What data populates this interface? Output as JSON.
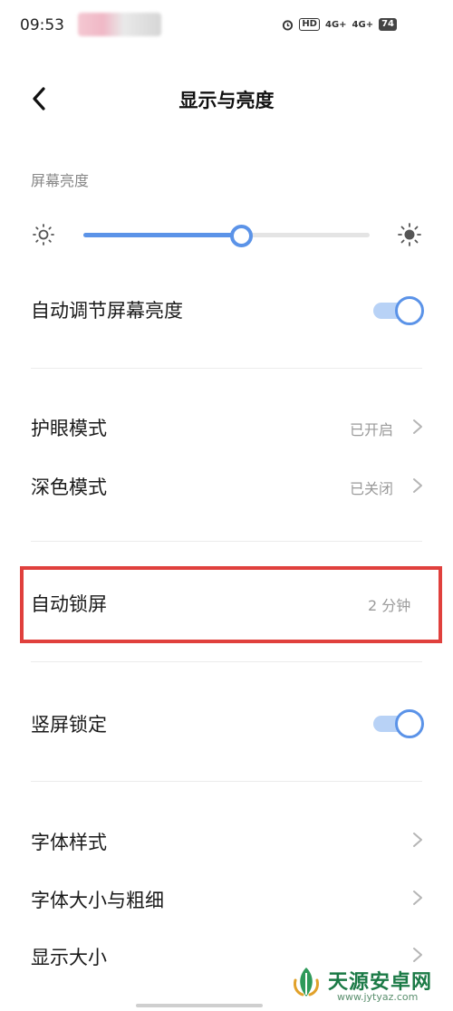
{
  "status_bar": {
    "time": "09:53",
    "battery": "74",
    "network1": "4G+",
    "network2": "4G+",
    "hd_badge": "HD"
  },
  "header": {
    "title": "显示与亮度"
  },
  "brightness": {
    "section_label": "屏幕亮度",
    "level": 0.55
  },
  "rows": {
    "auto_brightness": {
      "label": "自动调节屏幕亮度",
      "on": true
    },
    "eye_care": {
      "label": "护眼模式",
      "value": "已开启"
    },
    "dark_mode": {
      "label": "深色模式",
      "value": "已关闭"
    },
    "auto_lock": {
      "label": "自动锁屏",
      "value": "2 分钟"
    },
    "portrait_lock": {
      "label": "竖屏锁定",
      "on": true
    },
    "font_style": {
      "label": "字体样式"
    },
    "font_size_weight": {
      "label": "字体大小与粗细"
    },
    "display_size": {
      "label": "显示大小"
    }
  },
  "watermark": {
    "name": "天源安卓网",
    "url": "www.jytyaz.com"
  },
  "colors": {
    "accent": "#5b93e8",
    "highlight": "#e0403d"
  }
}
